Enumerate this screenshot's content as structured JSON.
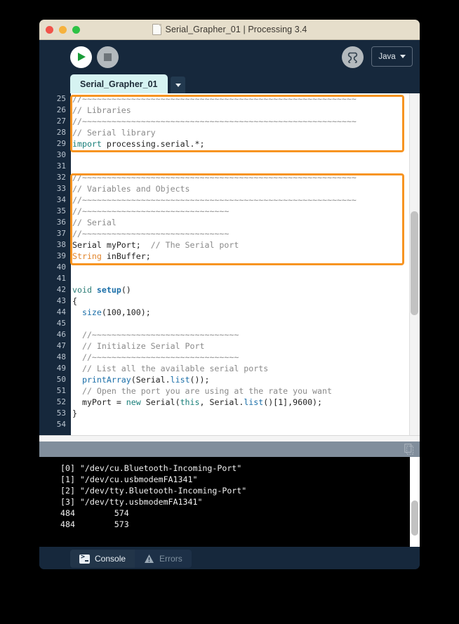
{
  "window": {
    "title": "Serial_Grapher_01 | Processing 3.4",
    "doc_icon": "document-icon",
    "traffic_lights": [
      "close",
      "minimize",
      "maximize"
    ]
  },
  "toolbar": {
    "run_label": "run-button",
    "stop_label": "stop-button",
    "debug_label": "debug-button",
    "mode": "Java",
    "mode_caret": "▼"
  },
  "tabstrip": {
    "sketch_tab": "Serial_Grapher_01",
    "menu_caret": "▼"
  },
  "editor": {
    "first_line": 25,
    "lines": [
      {
        "n": 25,
        "segments": [
          {
            "t": "//~~~~~~~~~~~~~~~~~~~~~~~~~~~~~~~~~~~~~~~~~~~~~~~~~~~~~~~~",
            "c": "c-com"
          }
        ]
      },
      {
        "n": 26,
        "segments": [
          {
            "t": "// Libraries",
            "c": "c-com"
          }
        ]
      },
      {
        "n": 27,
        "segments": [
          {
            "t": "//~~~~~~~~~~~~~~~~~~~~~~~~~~~~~~~~~~~~~~~~~~~~~~~~~~~~~~~~",
            "c": "c-com"
          }
        ]
      },
      {
        "n": 28,
        "segments": [
          {
            "t": "// Serial library",
            "c": "c-com"
          }
        ]
      },
      {
        "n": 29,
        "segments": [
          {
            "t": "import",
            "c": "c-type"
          },
          {
            "t": " processing.serial.*;",
            "c": "c-num"
          }
        ]
      },
      {
        "n": 30,
        "segments": []
      },
      {
        "n": 31,
        "segments": []
      },
      {
        "n": 32,
        "segments": [
          {
            "t": "//~~~~~~~~~~~~~~~~~~~~~~~~~~~~~~~~~~~~~~~~~~~~~~~~~~~~~~~~",
            "c": "c-com"
          }
        ]
      },
      {
        "n": 33,
        "segments": [
          {
            "t": "// Variables and Objects",
            "c": "c-com"
          }
        ]
      },
      {
        "n": 34,
        "segments": [
          {
            "t": "//~~~~~~~~~~~~~~~~~~~~~~~~~~~~~~~~~~~~~~~~~~~~~~~~~~~~~~~~",
            "c": "c-com"
          }
        ]
      },
      {
        "n": 35,
        "segments": [
          {
            "t": "//~~~~~~~~~~~~~~~~~~~~~~~~~~~~~~",
            "c": "c-com"
          }
        ]
      },
      {
        "n": 36,
        "segments": [
          {
            "t": "// Serial",
            "c": "c-com"
          }
        ]
      },
      {
        "n": 37,
        "segments": [
          {
            "t": "//~~~~~~~~~~~~~~~~~~~~~~~~~~~~~~",
            "c": "c-com"
          }
        ]
      },
      {
        "n": 38,
        "segments": [
          {
            "t": "Serial myPort;",
            "c": "c-num"
          },
          {
            "t": "  // The Serial port",
            "c": "c-com"
          }
        ]
      },
      {
        "n": 39,
        "segments": [
          {
            "t": "String",
            "c": "c-kw"
          },
          {
            "t": " inBuffer;",
            "c": "c-num"
          }
        ]
      },
      {
        "n": 40,
        "segments": []
      },
      {
        "n": 41,
        "segments": []
      },
      {
        "n": 42,
        "segments": [
          {
            "t": "void ",
            "c": "c-void"
          },
          {
            "t": "setup",
            "c": "c-fnb"
          },
          {
            "t": "()",
            "c": "c-num"
          }
        ]
      },
      {
        "n": 43,
        "segments": [
          {
            "t": "{",
            "c": "c-num"
          }
        ]
      },
      {
        "n": 44,
        "segments": [
          {
            "t": "  ",
            "c": "c-num"
          },
          {
            "t": "size",
            "c": "c-fn"
          },
          {
            "t": "(100,100);",
            "c": "c-num"
          }
        ]
      },
      {
        "n": 45,
        "segments": []
      },
      {
        "n": 46,
        "segments": [
          {
            "t": "  //~~~~~~~~~~~~~~~~~~~~~~~~~~~~~~",
            "c": "c-com"
          }
        ]
      },
      {
        "n": 47,
        "segments": [
          {
            "t": "  // Initialize Serial Port",
            "c": "c-com"
          }
        ]
      },
      {
        "n": 48,
        "segments": [
          {
            "t": "  //~~~~~~~~~~~~~~~~~~~~~~~~~~~~~~",
            "c": "c-com"
          }
        ]
      },
      {
        "n": 49,
        "segments": [
          {
            "t": "  // List all the available serial ports",
            "c": "c-com"
          }
        ]
      },
      {
        "n": 50,
        "segments": [
          {
            "t": "  ",
            "c": "c-num"
          },
          {
            "t": "printArray",
            "c": "c-fn"
          },
          {
            "t": "(Serial.",
            "c": "c-num"
          },
          {
            "t": "list",
            "c": "c-fn"
          },
          {
            "t": "());",
            "c": "c-num"
          }
        ]
      },
      {
        "n": 51,
        "segments": [
          {
            "t": "  // Open the port you are using at the rate you want",
            "c": "c-com"
          }
        ]
      },
      {
        "n": 52,
        "segments": [
          {
            "t": "  myPort = ",
            "c": "c-num"
          },
          {
            "t": "new",
            "c": "c-type"
          },
          {
            "t": " Serial(",
            "c": "c-num"
          },
          {
            "t": "this",
            "c": "c-type"
          },
          {
            "t": ", Serial.",
            "c": "c-num"
          },
          {
            "t": "list",
            "c": "c-fn"
          },
          {
            "t": "()[1],9600);",
            "c": "c-num"
          }
        ]
      },
      {
        "n": 53,
        "segments": [
          {
            "t": "}",
            "c": "c-num"
          }
        ]
      },
      {
        "n": 54,
        "segments": []
      }
    ],
    "highlight_boxes": 2,
    "highlight_color": "#f79421"
  },
  "console": {
    "copy_icon": "copy-icon",
    "lines": [
      "[0] \"/dev/cu.Bluetooth-Incoming-Port\"",
      "[1] \"/dev/cu.usbmodemFA1341\"",
      "[2] \"/dev/tty.Bluetooth-Incoming-Port\"",
      "[3] \"/dev/tty.usbmodemFA1341\"",
      "484        574",
      "484        573"
    ]
  },
  "bottom_tabs": {
    "console_label": "Console",
    "errors_label": "Errors",
    "active": "Console"
  }
}
